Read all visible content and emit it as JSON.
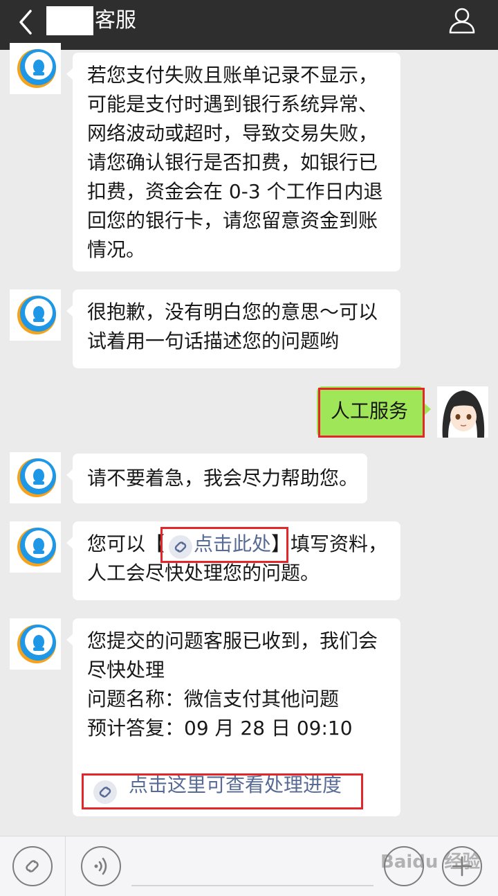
{
  "header": {
    "title": "客服",
    "back_icon": "chevron-left-icon",
    "profile_icon": "person-icon",
    "colors": {
      "bar": "#2e2e2e",
      "text": "#ffffff"
    }
  },
  "messages": [
    {
      "from": "service",
      "lines": [
        "若您支付失败且账单记录不显示，",
        "可能是支付时遇到银行系统异常、",
        "网络波动或超时，导致交易失败，",
        "请您确认银行是否扣费，如银行已",
        "扣费，资金会在 0-3 个工作日内退",
        "回您的银行卡，请您留意资金到账",
        "情况。"
      ]
    },
    {
      "from": "service",
      "lines": [
        "很抱歉，没有明白您的意思～可以",
        "试着用一句话描述您的问题哟"
      ]
    },
    {
      "from": "user",
      "text": "人工服务"
    },
    {
      "from": "service",
      "lines": [
        "请不要着急，我会尽力帮助您。"
      ]
    },
    {
      "from": "service",
      "prefix": "您可以【",
      "link": "点击此处",
      "suffix": "】填写资料，",
      "line2": "人工会尽快处理您的问题。"
    },
    {
      "from": "service",
      "lines": [
        "您提交的问题客服已收到，我们会",
        "尽快处理",
        "问题名称：微信支付其他问题",
        "预计答复：09 月 28 日 09:10"
      ],
      "link": "点击这里可查看处理进度"
    }
  ],
  "colors": {
    "background": "#ebebeb",
    "bubble_received": "#ffffff",
    "bubble_sent": "#9fe659",
    "link": "#576b95",
    "highlight": "#e3262a"
  },
  "bottom_bar": {
    "icons": [
      "miniprogram-link-icon",
      "voice-icon",
      "emoji-icon",
      "plus-icon"
    ],
    "watermark": "Baidu 经验"
  }
}
